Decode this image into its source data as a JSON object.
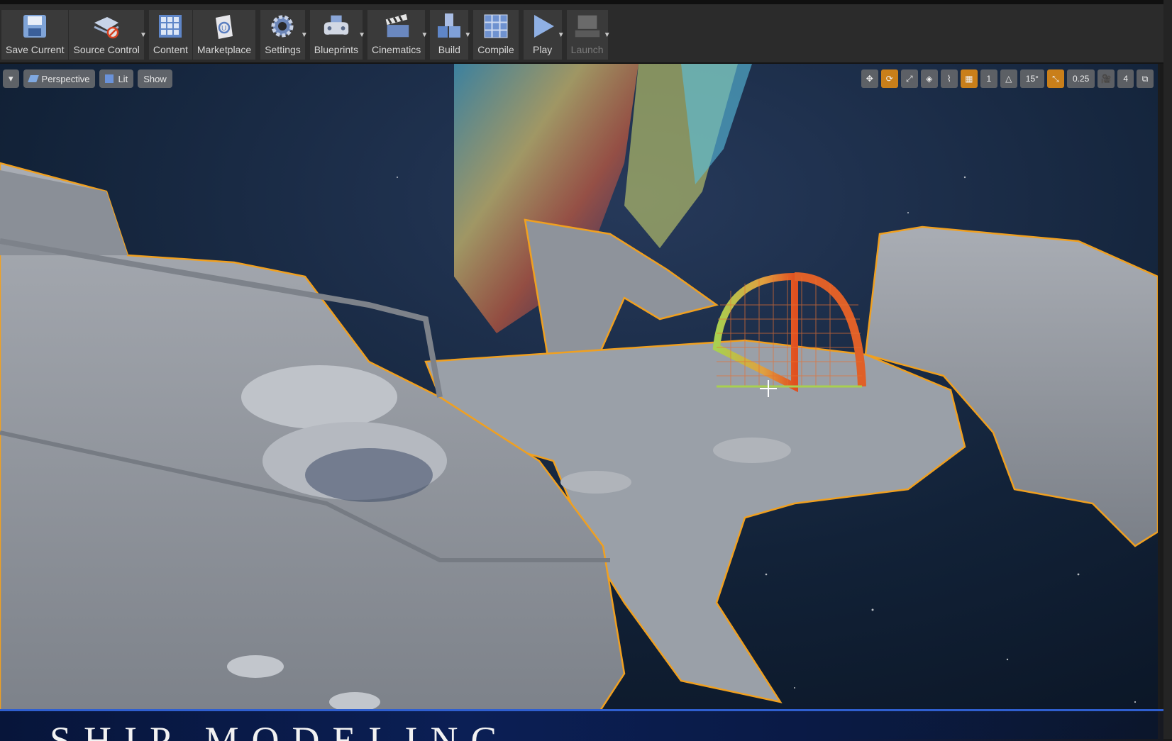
{
  "toolbar": {
    "items": [
      {
        "label": "Save Current",
        "icon": "save-icon",
        "dropdown": false,
        "enabled": true
      },
      {
        "label": "Source Control",
        "icon": "source-control-icon",
        "dropdown": true,
        "enabled": true
      },
      {
        "label": "Content",
        "icon": "content-grid-icon",
        "dropdown": false,
        "enabled": true
      },
      {
        "label": "Marketplace",
        "icon": "marketplace-icon",
        "dropdown": false,
        "enabled": true
      },
      {
        "label": "Settings",
        "icon": "settings-gear-icon",
        "dropdown": true,
        "enabled": true
      },
      {
        "label": "Blueprints",
        "icon": "blueprints-gamepad-icon",
        "dropdown": true,
        "enabled": true
      },
      {
        "label": "Cinematics",
        "icon": "clapperboard-icon",
        "dropdown": true,
        "enabled": true
      },
      {
        "label": "Build",
        "icon": "build-blocks-icon",
        "dropdown": true,
        "enabled": true
      },
      {
        "label": "Compile",
        "icon": "compile-cubes-icon",
        "dropdown": false,
        "enabled": true
      },
      {
        "label": "Play",
        "icon": "play-icon",
        "dropdown": true,
        "enabled": true
      },
      {
        "label": "Launch",
        "icon": "launch-icon",
        "dropdown": true,
        "enabled": false
      }
    ]
  },
  "viewport": {
    "view_mode": "Perspective",
    "lighting": "Lit",
    "show": "Show",
    "rotation_snap": "15°",
    "scale_snap": "0.25",
    "camera_speed": "4",
    "accent_color": "#c97f1a",
    "selection_outline_color": "#f0a020"
  },
  "banner": {
    "text": "SHIP MODELING"
  }
}
